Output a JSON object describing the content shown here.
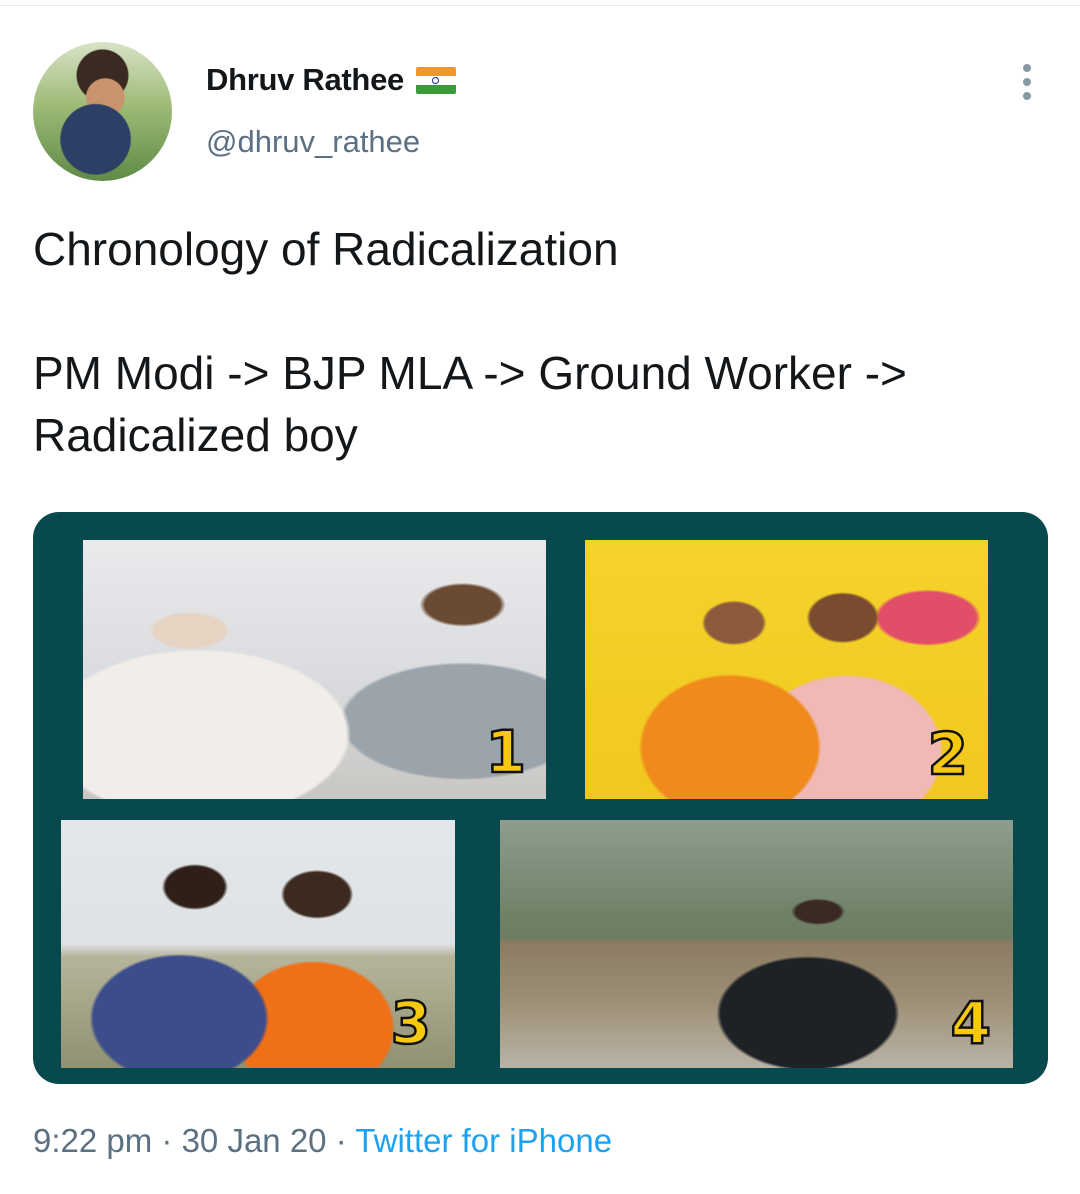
{
  "tweet": {
    "author": {
      "display_name": "Dhruv Rathee",
      "handle": "@dhruv_rathee",
      "flag_icon": "india-flag-icon",
      "avatar": "profile-photo"
    },
    "more_icon": "vertical-ellipsis-icon",
    "text": "Chronology of Radicalization\n\nPM Modi -> BJP MLA -> Ground Worker ->\nRadicalized boy",
    "media": {
      "background_color": "#07494d",
      "panels": [
        {
          "number": "1"
        },
        {
          "number": "2"
        },
        {
          "number": "3"
        },
        {
          "number": "4"
        }
      ]
    },
    "meta": {
      "time": "9:22 pm",
      "separator": " · ",
      "date": "30 Jan 20",
      "source": "Twitter for iPhone"
    }
  },
  "colors": {
    "text": "#14171a",
    "secondary": "#5b7083",
    "link": "#1da1f2",
    "number_fill": "#f6c90e"
  }
}
